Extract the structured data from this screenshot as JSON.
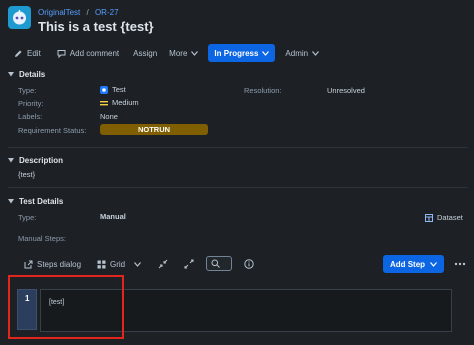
{
  "header": {
    "project": "OriginalTest",
    "separator": "/",
    "issue_key": "OR-27",
    "title": "This is a test {test}"
  },
  "toolbar": {
    "edit": "Edit",
    "add_comment": "Add comment",
    "assign": "Assign",
    "more": "More",
    "status": "In Progress",
    "admin": "Admin"
  },
  "details": {
    "heading": "Details",
    "type_label": "Type:",
    "type_value": "Test",
    "priority_label": "Priority:",
    "priority_value": "Medium",
    "labels_label": "Labels:",
    "labels_value": "None",
    "req_label": "Requirement Status:",
    "req_value": "NOTRUN",
    "resolution_label": "Resolution:",
    "resolution_value": "Unresolved"
  },
  "description": {
    "heading": "Description",
    "text": "{test}"
  },
  "test_details": {
    "heading": "Test Details",
    "type_label": "Type:",
    "type_value": "Manual",
    "dataset": "Dataset",
    "manual_steps_label": "Manual Steps:"
  },
  "steps_toolbar": {
    "steps_dialog": "Steps dialog",
    "grid": "Grid",
    "add_step": "Add Step"
  },
  "steps": [
    {
      "number": "1",
      "action": "[test]"
    }
  ],
  "colors": {
    "background": "#1d2125",
    "accent": "#0c66e4",
    "notrun": "#7f5f01",
    "highlight": "#e2251d"
  }
}
